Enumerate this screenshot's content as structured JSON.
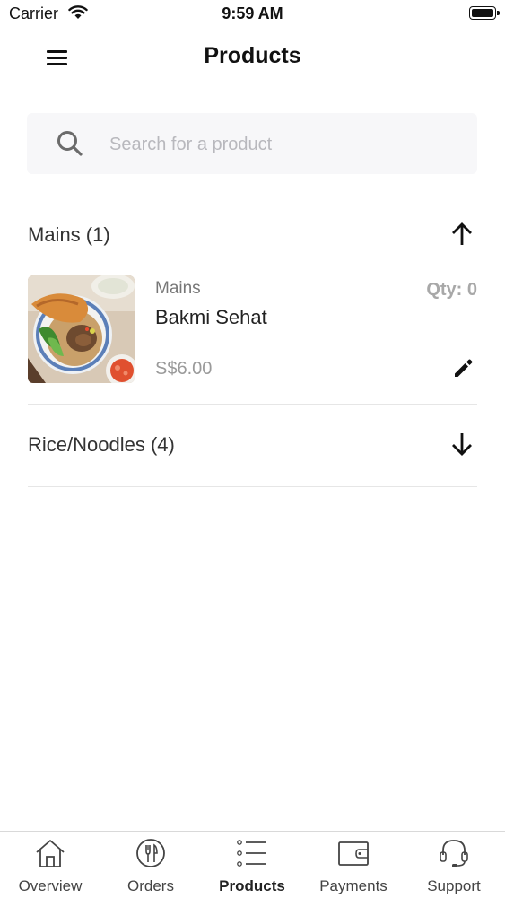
{
  "status_bar": {
    "carrier": "Carrier",
    "time": "9:59 AM"
  },
  "header": {
    "title": "Products"
  },
  "search": {
    "placeholder": "Search for a product",
    "value": ""
  },
  "sections": [
    {
      "title": "Mains (1)",
      "expanded": true,
      "arrow_icon": "arrow-up-icon",
      "products": [
        {
          "category": "Mains",
          "name": "Bakmi Sehat",
          "price": "S$6.00",
          "qty": "Qty: 0"
        }
      ]
    },
    {
      "title": "Rice/Noodles (4)",
      "expanded": false,
      "arrow_icon": "arrow-down-icon"
    }
  ],
  "tab_bar": {
    "active": "Products",
    "tabs": [
      {
        "label": "Overview",
        "icon": "home-icon"
      },
      {
        "label": "Orders",
        "icon": "utensils-icon"
      },
      {
        "label": "Products",
        "icon": "list-icon"
      },
      {
        "label": "Payments",
        "icon": "wallet-icon"
      },
      {
        "label": "Support",
        "icon": "headset-icon"
      }
    ]
  },
  "colors": {
    "text": "#222222",
    "muted": "#9a9a9a",
    "search_bg": "#f7f7f9",
    "divider": "#e6e6e6"
  }
}
